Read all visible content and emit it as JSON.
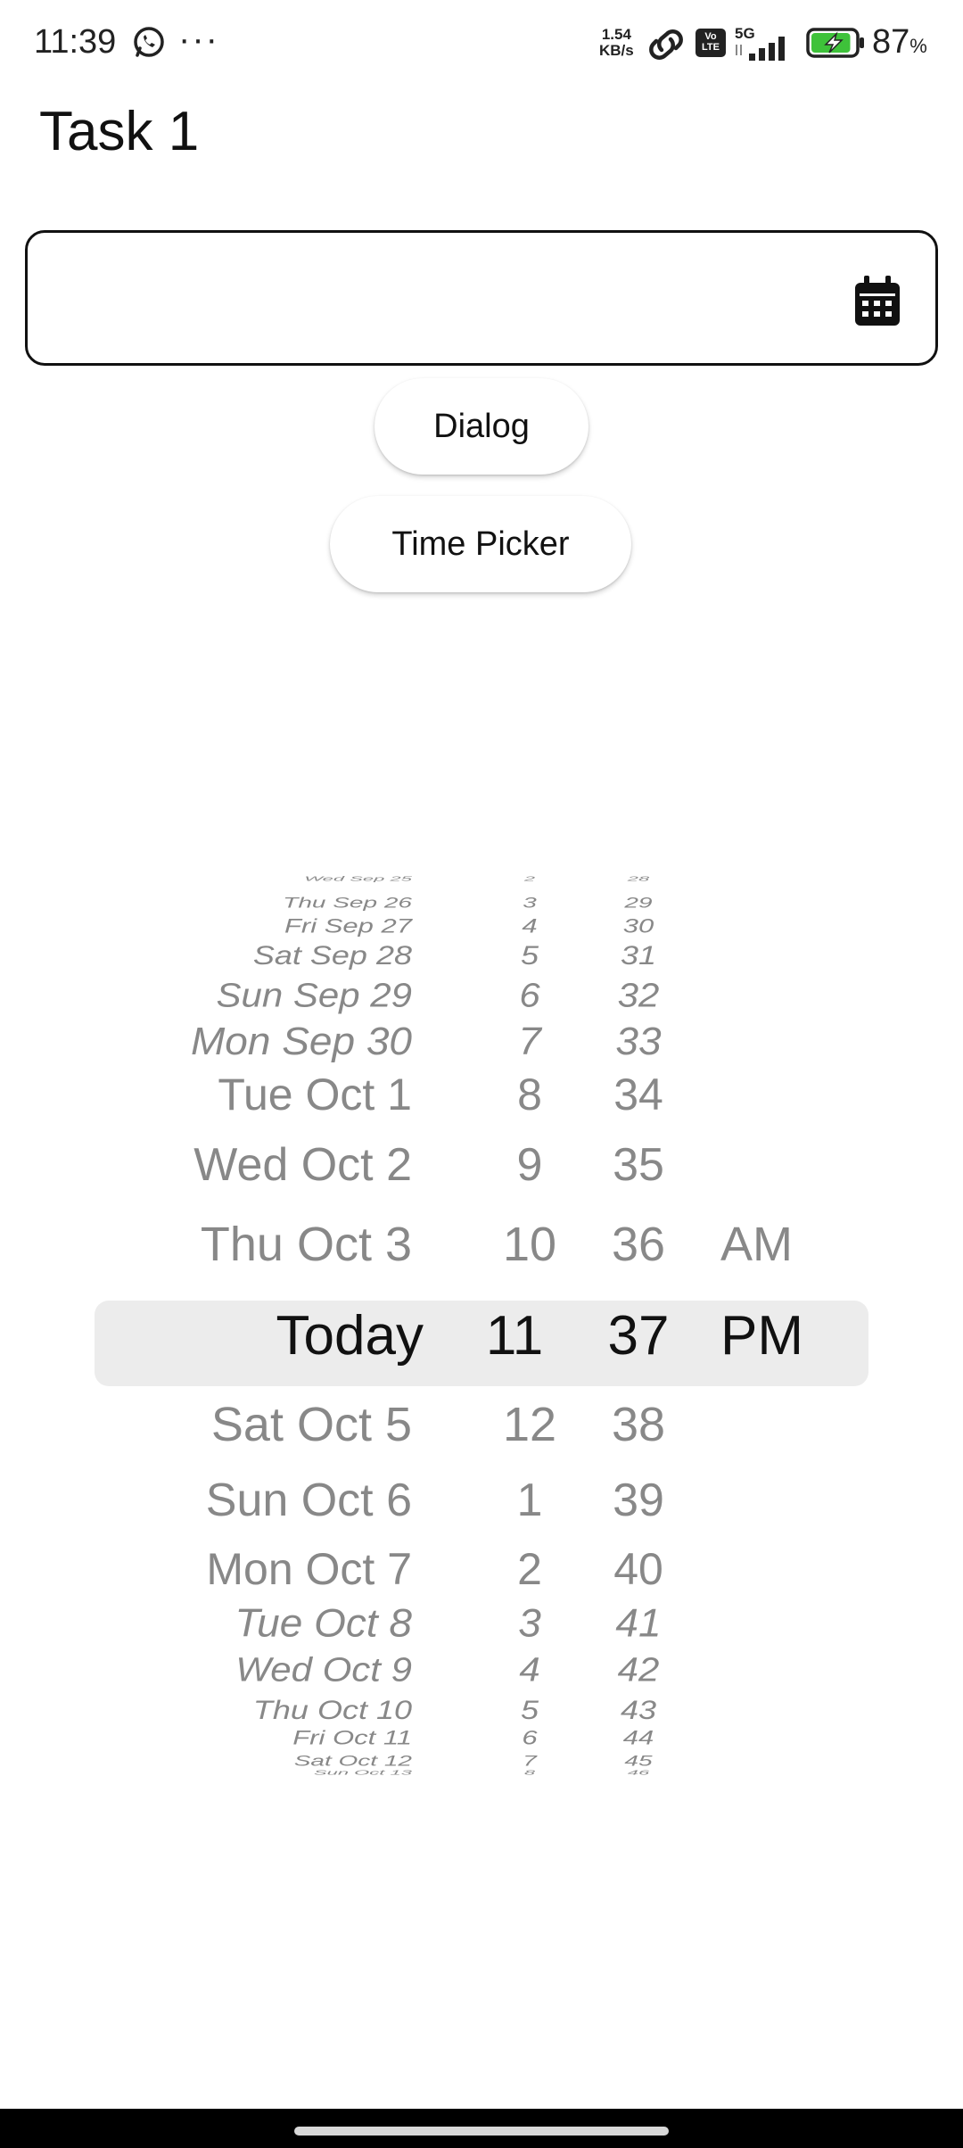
{
  "status_bar": {
    "time": "11:39",
    "network_speed_value": "1.54",
    "network_speed_unit": "KB/s",
    "volte_label": "Vo LTE",
    "network_type": "5G",
    "battery_percent": "87",
    "battery_percent_sign": "%",
    "battery_level": 0.87
  },
  "app": {
    "title": "Task 1"
  },
  "date_field": {
    "value": "",
    "icon": "calendar-icon"
  },
  "buttons": {
    "dialog_label": "Dialog",
    "time_picker_label": "Time Picker"
  },
  "picker": {
    "rows_above": [
      {
        "date": "Wed Sep 25",
        "hour": "2",
        "minute": "28"
      },
      {
        "date": "Thu Sep 26",
        "hour": "3",
        "minute": "29"
      },
      {
        "date": "Fri Sep 27",
        "hour": "4",
        "minute": "30"
      },
      {
        "date": "Sat Sep 28",
        "hour": "5",
        "minute": "31"
      },
      {
        "date": "Sun Sep 29",
        "hour": "6",
        "minute": "32"
      },
      {
        "date": "Mon Sep 30",
        "hour": "7",
        "minute": "33"
      },
      {
        "date": "Tue Oct 1",
        "hour": "8",
        "minute": "34"
      },
      {
        "date": "Wed Oct 2",
        "hour": "9",
        "minute": "35"
      },
      {
        "date": "Thu Oct 3",
        "hour": "10",
        "minute": "36",
        "ampm": "AM"
      }
    ],
    "selected": {
      "date": "Today",
      "hour": "11",
      "minute": "37",
      "ampm": "PM"
    },
    "rows_below": [
      {
        "date": "Sat Oct 5",
        "hour": "12",
        "minute": "38"
      },
      {
        "date": "Sun Oct 6",
        "hour": "1",
        "minute": "39"
      },
      {
        "date": "Mon Oct 7",
        "hour": "2",
        "minute": "40"
      },
      {
        "date": "Tue Oct 8",
        "hour": "3",
        "minute": "41"
      },
      {
        "date": "Wed Oct 9",
        "hour": "4",
        "minute": "42"
      },
      {
        "date": "Thu Oct 10",
        "hour": "5",
        "minute": "43"
      },
      {
        "date": "Fri Oct 11",
        "hour": "6",
        "minute": "44"
      },
      {
        "date": "Sat Oct 12",
        "hour": "7",
        "minute": "45"
      },
      {
        "date": "Sun Oct 13",
        "hour": "8",
        "minute": "46"
      }
    ]
  }
}
